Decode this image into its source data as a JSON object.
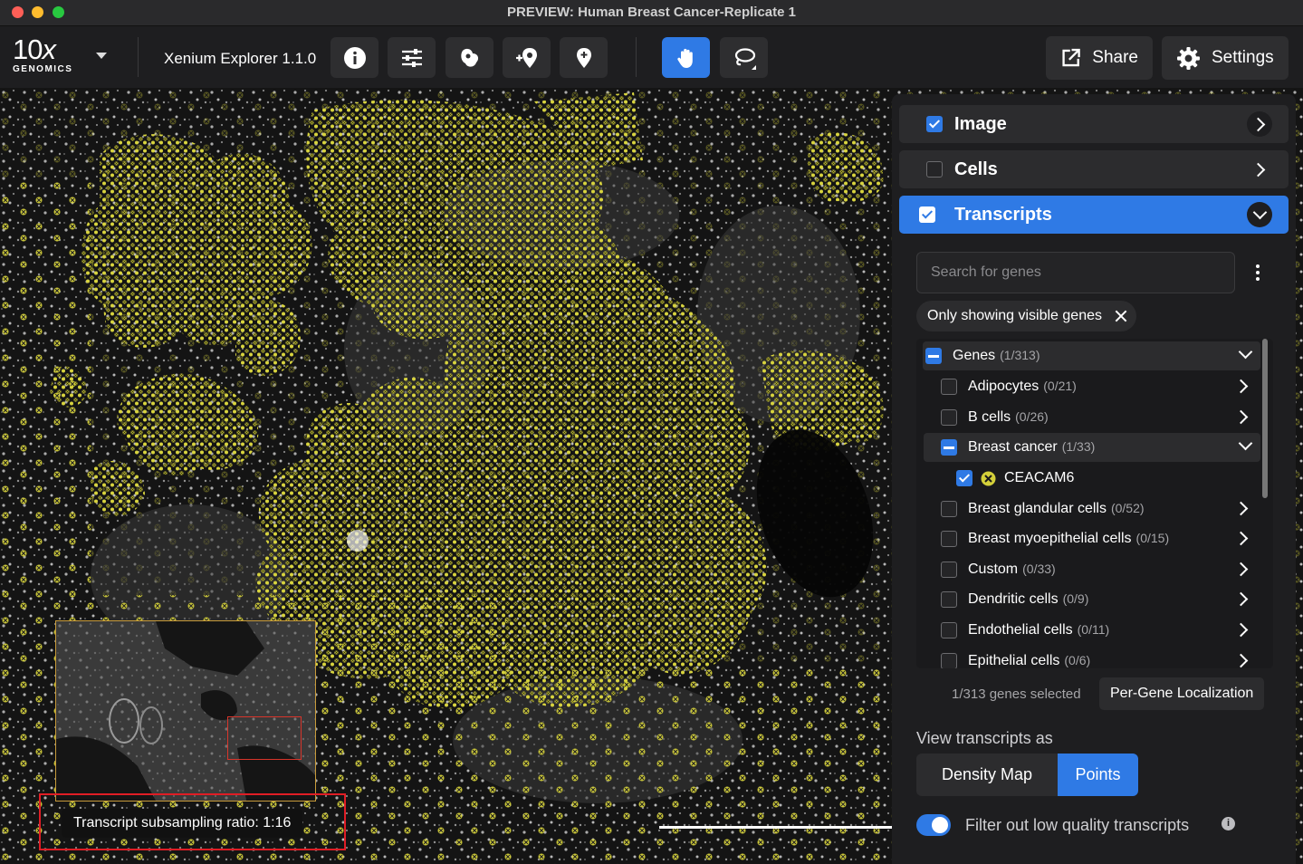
{
  "window": {
    "title": "PREVIEW: Human Breast Cancer-Replicate 1"
  },
  "toolbar": {
    "logo_main": "10",
    "logo_x": "x",
    "logo_sub": "GENOMICS",
    "app_name": "Xenium Explorer 1.1.0",
    "tools": [
      "info-icon",
      "sliders-icon",
      "cell-shape-icon",
      "add-pin-icon",
      "pin-icon",
      "pan-hand-icon",
      "lasso-icon"
    ],
    "active_tool": "pan-hand-icon",
    "share_label": "Share",
    "settings_label": "Settings",
    "accent_color": "#2f7ae5"
  },
  "viewer": {
    "subsampling_label": "Transcript subsampling ratio: 1:16",
    "transcript_color": "#d4d03a",
    "highlight_box_color": "#e01d25"
  },
  "panel": {
    "layers": [
      {
        "label": "Image",
        "checked": true,
        "expanded": false
      },
      {
        "label": "Cells",
        "checked": false,
        "expanded": false
      },
      {
        "label": "Transcripts",
        "checked": true,
        "expanded": true
      }
    ],
    "search_placeholder": "Search for genes",
    "filter_chip": "Only showing visible genes",
    "genes_tree": [
      {
        "label": "Genes",
        "count": "(1/313)",
        "state": "partial",
        "level": 0,
        "expanded": true
      },
      {
        "label": "Adipocytes",
        "count": "(0/21)",
        "state": "off",
        "level": 1
      },
      {
        "label": "B cells",
        "count": "(0/26)",
        "state": "off",
        "level": 1
      },
      {
        "label": "Breast cancer",
        "count": "(1/33)",
        "state": "partial",
        "level": 1,
        "expanded": true
      },
      {
        "label": "CEACAM6",
        "count": "",
        "state": "on",
        "level": 2,
        "gene": true
      },
      {
        "label": "Breast glandular cells",
        "count": "(0/52)",
        "state": "off",
        "level": 1
      },
      {
        "label": "Breast myoepithelial cells",
        "count": "(0/15)",
        "state": "off",
        "level": 1
      },
      {
        "label": "Custom",
        "count": "(0/33)",
        "state": "off",
        "level": 1
      },
      {
        "label": "Dendritic cells",
        "count": "(0/9)",
        "state": "off",
        "level": 1
      },
      {
        "label": "Endothelial cells",
        "count": "(0/11)",
        "state": "off",
        "level": 1
      },
      {
        "label": "Epithelial cells",
        "count": "(0/6)",
        "state": "off",
        "level": 1
      }
    ],
    "selected_count": "1/313 genes selected",
    "localization_button": "Per-Gene Localization",
    "view_as_label": "View transcripts as",
    "view_modes": [
      "Density Map",
      "Points"
    ],
    "view_mode_selected": "Points",
    "filter_toggle_label": "Filter out low quality transcripts",
    "filter_toggle_on": true
  }
}
